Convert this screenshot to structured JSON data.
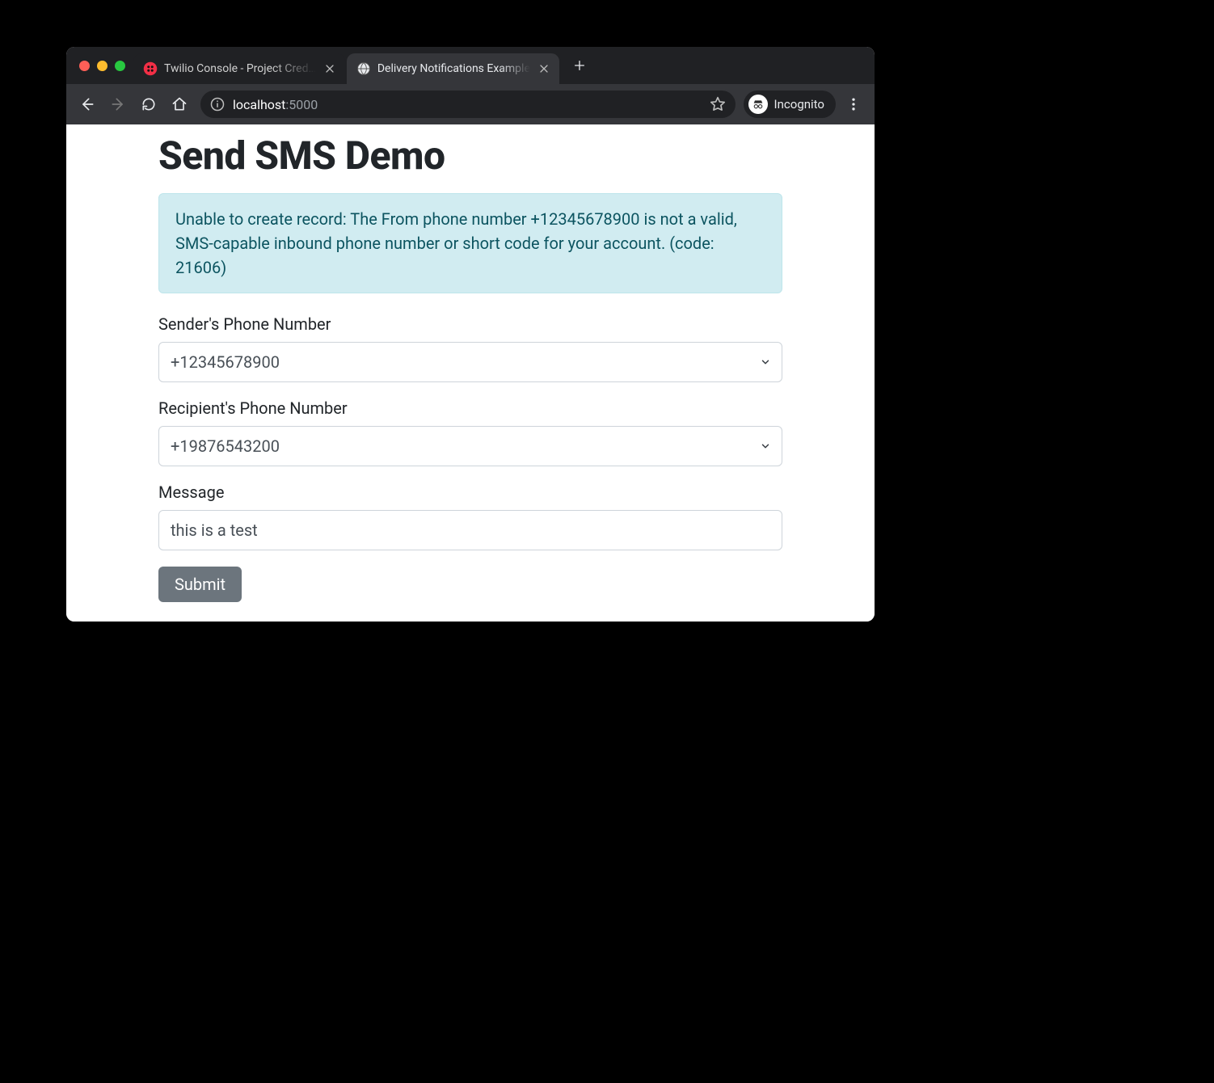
{
  "browser": {
    "tabs": [
      {
        "title": "Twilio Console - Project Cred…",
        "active": false,
        "favicon": "twilio"
      },
      {
        "title": "Delivery Notifications Example",
        "active": true,
        "favicon": "globe"
      }
    ],
    "address": {
      "host": "localhost",
      "port": ":5000"
    },
    "incognito_label": "Incognito"
  },
  "page": {
    "title": "Send SMS Demo",
    "alert": "Unable to create record: The From phone number +12345678900 is not a valid, SMS-capable inbound phone number or short code for your account. (code: 21606)",
    "form": {
      "sender_label": "Sender's Phone Number",
      "sender_value": "+12345678900",
      "recipient_label": "Recipient's Phone Number",
      "recipient_value": "+19876543200",
      "message_label": "Message",
      "message_value": "this is a test",
      "submit_label": "Submit"
    }
  }
}
